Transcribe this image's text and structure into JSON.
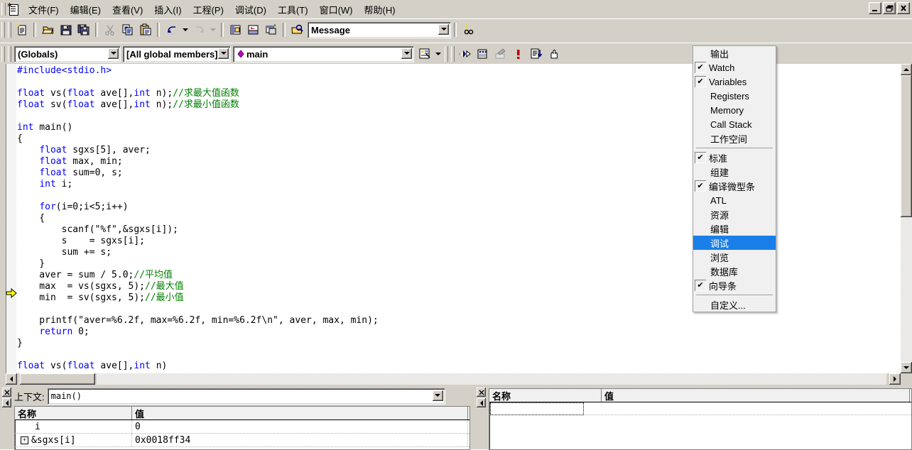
{
  "window": {
    "min_label": "_",
    "restore_label": "❐",
    "close_label": "✕"
  },
  "menubar": {
    "items": [
      {
        "label": "文件(F)",
        "key": "F"
      },
      {
        "label": "编辑(E)",
        "key": "E"
      },
      {
        "label": "查看(V)",
        "key": "V"
      },
      {
        "label": "插入(I)",
        "key": "I"
      },
      {
        "label": "工程(P)",
        "key": "P"
      },
      {
        "label": "调试(D)",
        "key": "D"
      },
      {
        "label": "工具(T)",
        "key": "T"
      },
      {
        "label": "窗口(W)",
        "key": "W"
      },
      {
        "label": "帮助(H)",
        "key": "H"
      }
    ]
  },
  "toolbar_standard": {
    "buttons": [
      "new-document-icon",
      "open-folder-icon",
      "save-icon",
      "save-all-icon",
      "cut-scissors-icon",
      "copy-icon",
      "paste-icon",
      "undo-icon",
      "undo-dropdown-icon",
      "redo-icon",
      "redo-dropdown-icon",
      "workspace-icon",
      "output-window-icon",
      "window-list-icon",
      "find-in-files-icon"
    ],
    "find_combo": {
      "value": "Message",
      "placeholder": "Message"
    },
    "help_icon": "help-search-icon"
  },
  "toolbar_wizardbar": {
    "class_combo": {
      "value": "(Globals)"
    },
    "members_combo": {
      "value": "[All global members]"
    },
    "function_combo": {
      "value": "main",
      "icon": "member-diamond-icon"
    },
    "action_icon": "wizardbar-actions-icon",
    "action_dropdown_icon": "chevron-down-icon",
    "debug_buttons": [
      "go-icon",
      "insert-remove-breakpoint-icon",
      "remove-all-breakpoints-icon",
      "exception-icon",
      "step-into-icon",
      "hand-pan-icon"
    ]
  },
  "editor": {
    "exec_marker": "yellow-arrow-icon",
    "lines": [
      {
        "segments": [
          {
            "t": "#include<stdio.h>",
            "c": "kw"
          }
        ]
      },
      {
        "segments": [
          {
            "t": "",
            "c": ""
          }
        ]
      },
      {
        "segments": [
          {
            "t": "float",
            "c": "kw"
          },
          {
            "t": " vs(",
            "c": ""
          },
          {
            "t": "float",
            "c": "kw"
          },
          {
            "t": " ave[],",
            "c": ""
          },
          {
            "t": "int",
            "c": "kw"
          },
          {
            "t": " n);",
            "c": ""
          },
          {
            "t": "//求最大值函数",
            "c": "cm"
          }
        ]
      },
      {
        "segments": [
          {
            "t": "float",
            "c": "kw"
          },
          {
            "t": " sv(",
            "c": ""
          },
          {
            "t": "float",
            "c": "kw"
          },
          {
            "t": " ave[],",
            "c": ""
          },
          {
            "t": "int",
            "c": "kw"
          },
          {
            "t": " n);",
            "c": ""
          },
          {
            "t": "//求最小值函数",
            "c": "cm"
          }
        ]
      },
      {
        "segments": [
          {
            "t": "",
            "c": ""
          }
        ]
      },
      {
        "segments": [
          {
            "t": "int",
            "c": "kw"
          },
          {
            "t": " main()",
            "c": ""
          }
        ]
      },
      {
        "segments": [
          {
            "t": "{",
            "c": ""
          }
        ]
      },
      {
        "segments": [
          {
            "t": "    ",
            "c": ""
          },
          {
            "t": "float",
            "c": "kw"
          },
          {
            "t": " sgxs[5], aver;",
            "c": ""
          }
        ]
      },
      {
        "segments": [
          {
            "t": "    ",
            "c": ""
          },
          {
            "t": "float",
            "c": "kw"
          },
          {
            "t": " max, min;",
            "c": ""
          }
        ]
      },
      {
        "segments": [
          {
            "t": "    ",
            "c": ""
          },
          {
            "t": "float",
            "c": "kw"
          },
          {
            "t": " sum=0, s;",
            "c": ""
          }
        ]
      },
      {
        "segments": [
          {
            "t": "    ",
            "c": ""
          },
          {
            "t": "int",
            "c": "kw"
          },
          {
            "t": " i;",
            "c": ""
          }
        ]
      },
      {
        "segments": [
          {
            "t": "",
            "c": ""
          }
        ]
      },
      {
        "segments": [
          {
            "t": "    ",
            "c": ""
          },
          {
            "t": "for",
            "c": "kw"
          },
          {
            "t": "(i=0;i<5;i++)",
            "c": ""
          }
        ]
      },
      {
        "segments": [
          {
            "t": "    {",
            "c": ""
          }
        ]
      },
      {
        "segments": [
          {
            "t": "        scanf(\"%f\",&sgxs[i]);",
            "c": ""
          }
        ]
      },
      {
        "segments": [
          {
            "t": "        s    = sgxs[i];",
            "c": ""
          }
        ]
      },
      {
        "segments": [
          {
            "t": "        sum += s;",
            "c": ""
          }
        ]
      },
      {
        "segments": [
          {
            "t": "    }",
            "c": ""
          }
        ]
      },
      {
        "segments": [
          {
            "t": "    aver = sum / 5.0;",
            "c": ""
          },
          {
            "t": "//平均值",
            "c": "cm"
          }
        ]
      },
      {
        "segments": [
          {
            "t": "    max  = vs(sgxs, 5);",
            "c": ""
          },
          {
            "t": "//最大值",
            "c": "cm"
          }
        ]
      },
      {
        "segments": [
          {
            "t": "    min  = sv(sgxs, 5);",
            "c": ""
          },
          {
            "t": "//最小值",
            "c": "cm"
          }
        ]
      },
      {
        "segments": [
          {
            "t": "",
            "c": ""
          }
        ]
      },
      {
        "segments": [
          {
            "t": "    printf(\"aver=%6.2f, max=%6.2f, min=%6.2f\\n\", aver, max, min);",
            "c": ""
          }
        ]
      },
      {
        "segments": [
          {
            "t": "    ",
            "c": ""
          },
          {
            "t": "return",
            "c": "kw"
          },
          {
            "t": " 0;",
            "c": ""
          }
        ]
      },
      {
        "segments": [
          {
            "t": "}",
            "c": ""
          }
        ]
      },
      {
        "segments": [
          {
            "t": "",
            "c": ""
          }
        ]
      },
      {
        "segments": [
          {
            "t": "float",
            "c": "kw"
          },
          {
            "t": " vs(",
            "c": ""
          },
          {
            "t": "float",
            "c": "kw"
          },
          {
            "t": " ave[],",
            "c": ""
          },
          {
            "t": "int",
            "c": "kw"
          },
          {
            "t": " n)",
            "c": ""
          }
        ]
      }
    ]
  },
  "popup_menu": {
    "items": [
      {
        "label": "输出",
        "checked": false,
        "selected": false
      },
      {
        "label": "Watch",
        "checked": true,
        "selected": false
      },
      {
        "label": "Variables",
        "checked": true,
        "selected": false
      },
      {
        "label": "Registers",
        "checked": false,
        "selected": false
      },
      {
        "label": "Memory",
        "checked": false,
        "selected": false
      },
      {
        "label": "Call Stack",
        "checked": false,
        "selected": false
      },
      {
        "label": "工作空间",
        "checked": false,
        "selected": false
      },
      {
        "separator": true
      },
      {
        "label": "标准",
        "checked": true,
        "selected": false
      },
      {
        "label": "组建",
        "checked": false,
        "selected": false
      },
      {
        "label": "编译微型条",
        "checked": true,
        "selected": false
      },
      {
        "label": "ATL",
        "checked": false,
        "selected": false
      },
      {
        "label": "资源",
        "checked": false,
        "selected": false
      },
      {
        "label": "编辑",
        "checked": false,
        "selected": false
      },
      {
        "label": "调试",
        "checked": false,
        "selected": true
      },
      {
        "label": "浏览",
        "checked": false,
        "selected": false
      },
      {
        "label": "数据库",
        "checked": false,
        "selected": false
      },
      {
        "label": "向导条",
        "checked": true,
        "selected": false
      },
      {
        "separator": true
      },
      {
        "label": "自定义...",
        "checked": false,
        "selected": false
      }
    ],
    "check_glyph": "✔",
    "highlight_color": "#1a7fe8"
  },
  "variables_pane": {
    "close_icon": "close-small-icon",
    "scroll_icon": "left-arrow-small-icon",
    "context_label": "上下文:",
    "context_value": "main()",
    "columns": [
      "名称",
      "值"
    ],
    "rows": [
      {
        "name": "i",
        "value": "0",
        "expandable": false
      },
      {
        "name": "&sgxs[i]",
        "value": "0x0018ff34",
        "expandable": true,
        "expand_glyph": "+"
      }
    ]
  },
  "watch_pane": {
    "close_icon": "close-small-icon",
    "scroll_icon": "left-arrow-small-icon",
    "columns": [
      "名称",
      "值"
    ],
    "rows": [
      {
        "name": "",
        "value": "",
        "editing": true
      }
    ]
  },
  "colors": {
    "chrome": "#d4d0c8",
    "keyword": "#0000ff",
    "comment": "#008000",
    "editor_bg": "#ffffff",
    "selection": "#1a7fe8",
    "marker_yellow": "#ffff00"
  }
}
